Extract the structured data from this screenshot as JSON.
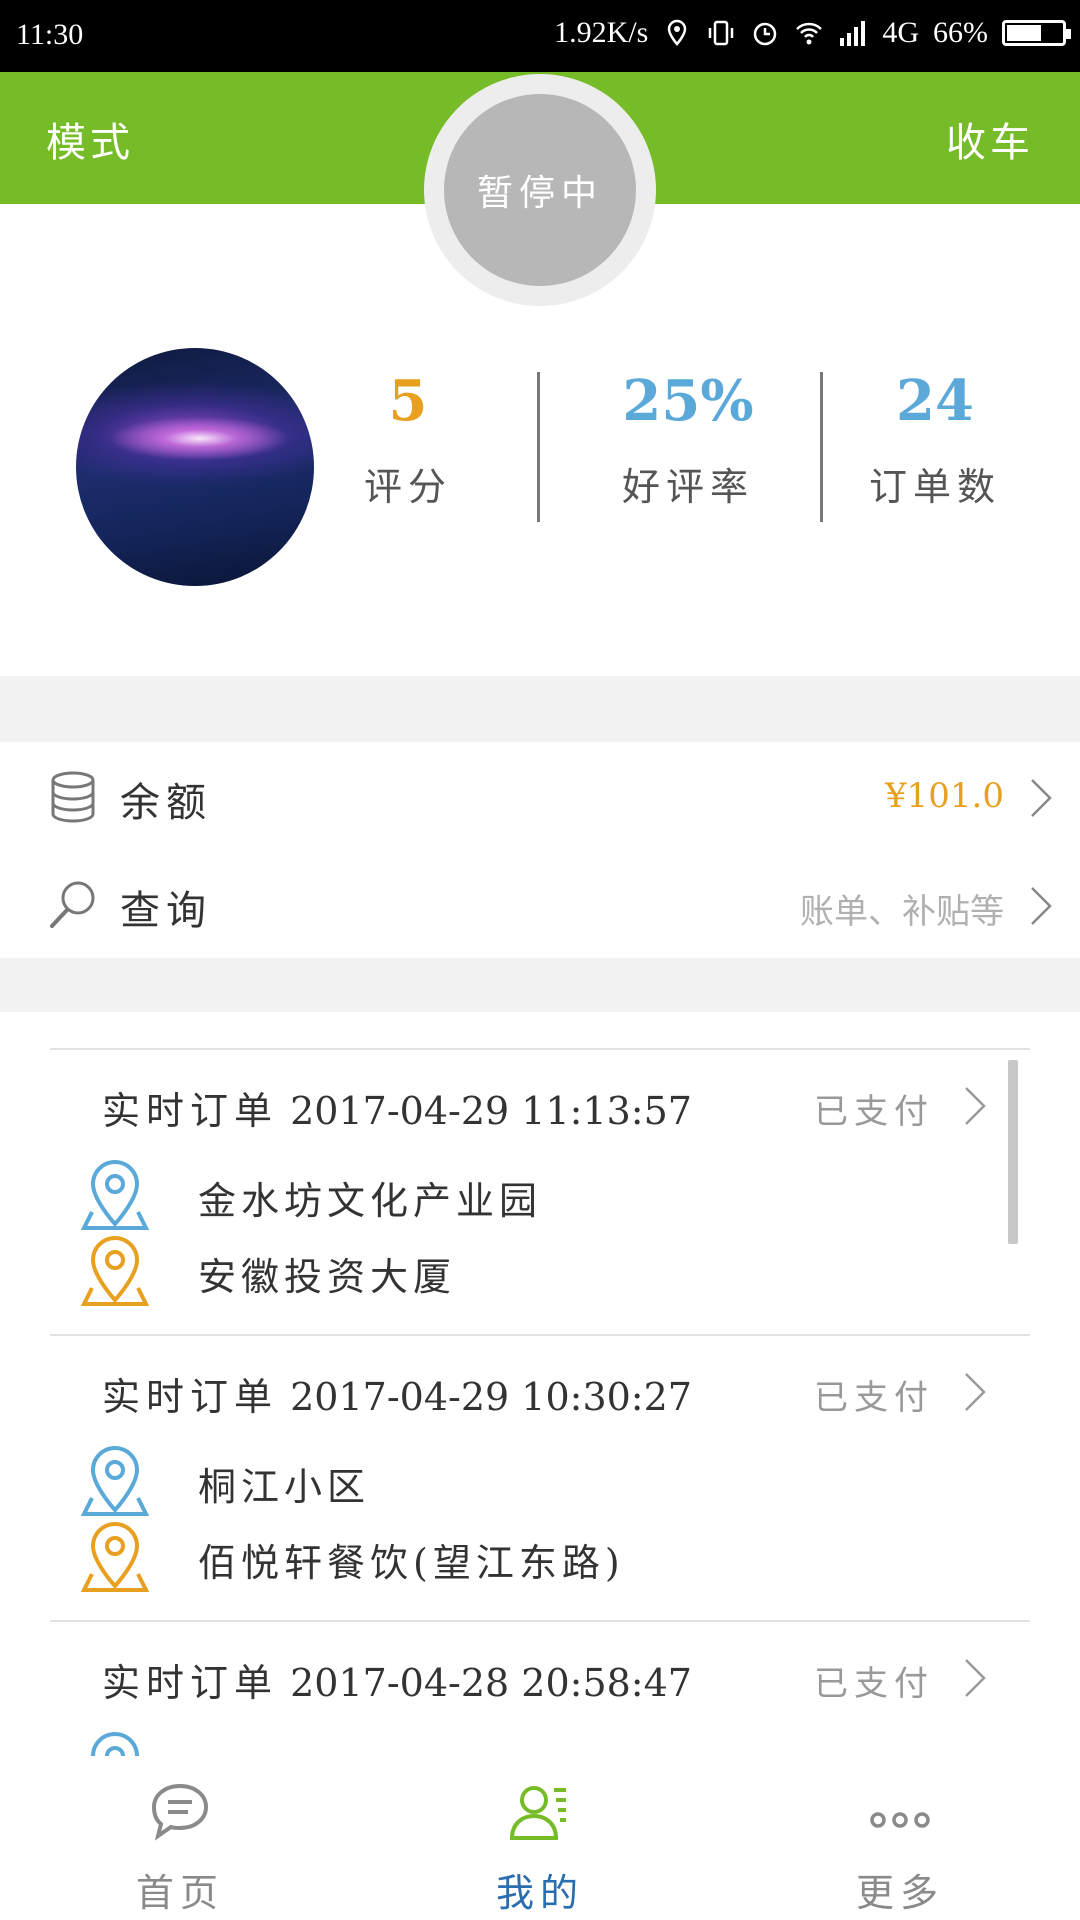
{
  "status_bar": {
    "time": "11:30",
    "net_speed": "1.92K/s",
    "network": "4G",
    "battery": "66%",
    "battery_level": 0.66
  },
  "header": {
    "mode_label": "模式",
    "finish_label": "收车",
    "pause_label": "暂停中",
    "accent_color": "#76bc28"
  },
  "profile": {
    "stats": [
      {
        "value": "5",
        "label": "评分",
        "color": "#e8a020"
      },
      {
        "value": "25%",
        "label": "好评率",
        "color": "#5aa9d8"
      },
      {
        "value": "24",
        "label": "订单数",
        "color": "#5aa9d8"
      }
    ]
  },
  "menu": {
    "balance": {
      "icon": "database-icon",
      "label": "余额",
      "value": "¥101.0",
      "value_color": "#e8a020"
    },
    "query": {
      "icon": "search-icon",
      "label": "查询",
      "value": "账单、补贴等",
      "value_color": "#b0b0b0"
    }
  },
  "orders": [
    {
      "type": "实时订单",
      "datetime": "2017-04-29 11:13:57",
      "status": "已支付",
      "from": "金水坊文化产业园",
      "to": "安徽投资大厦"
    },
    {
      "type": "实时订单",
      "datetime": "2017-04-29 10:30:27",
      "status": "已支付",
      "from": "桐江小区",
      "to": "佰悦轩餐饮(望江东路)"
    },
    {
      "type": "实时订单",
      "datetime": "2017-04-28 20:58:47",
      "status": "已支付",
      "from": "",
      "to": ""
    }
  ],
  "tabs": [
    {
      "label": "首页",
      "icon": "chat-bubble-icon",
      "active": false
    },
    {
      "label": "我的",
      "icon": "user-list-icon",
      "active": true
    },
    {
      "label": "更多",
      "icon": "more-dots-icon",
      "active": false
    }
  ],
  "colors": {
    "from_pin": "#5aa9d8",
    "to_pin": "#e8a020",
    "tab_inactive": "#8a8a8a",
    "tab_active_text": "#2a6db0",
    "tab_active_icon": "#76bc28"
  }
}
